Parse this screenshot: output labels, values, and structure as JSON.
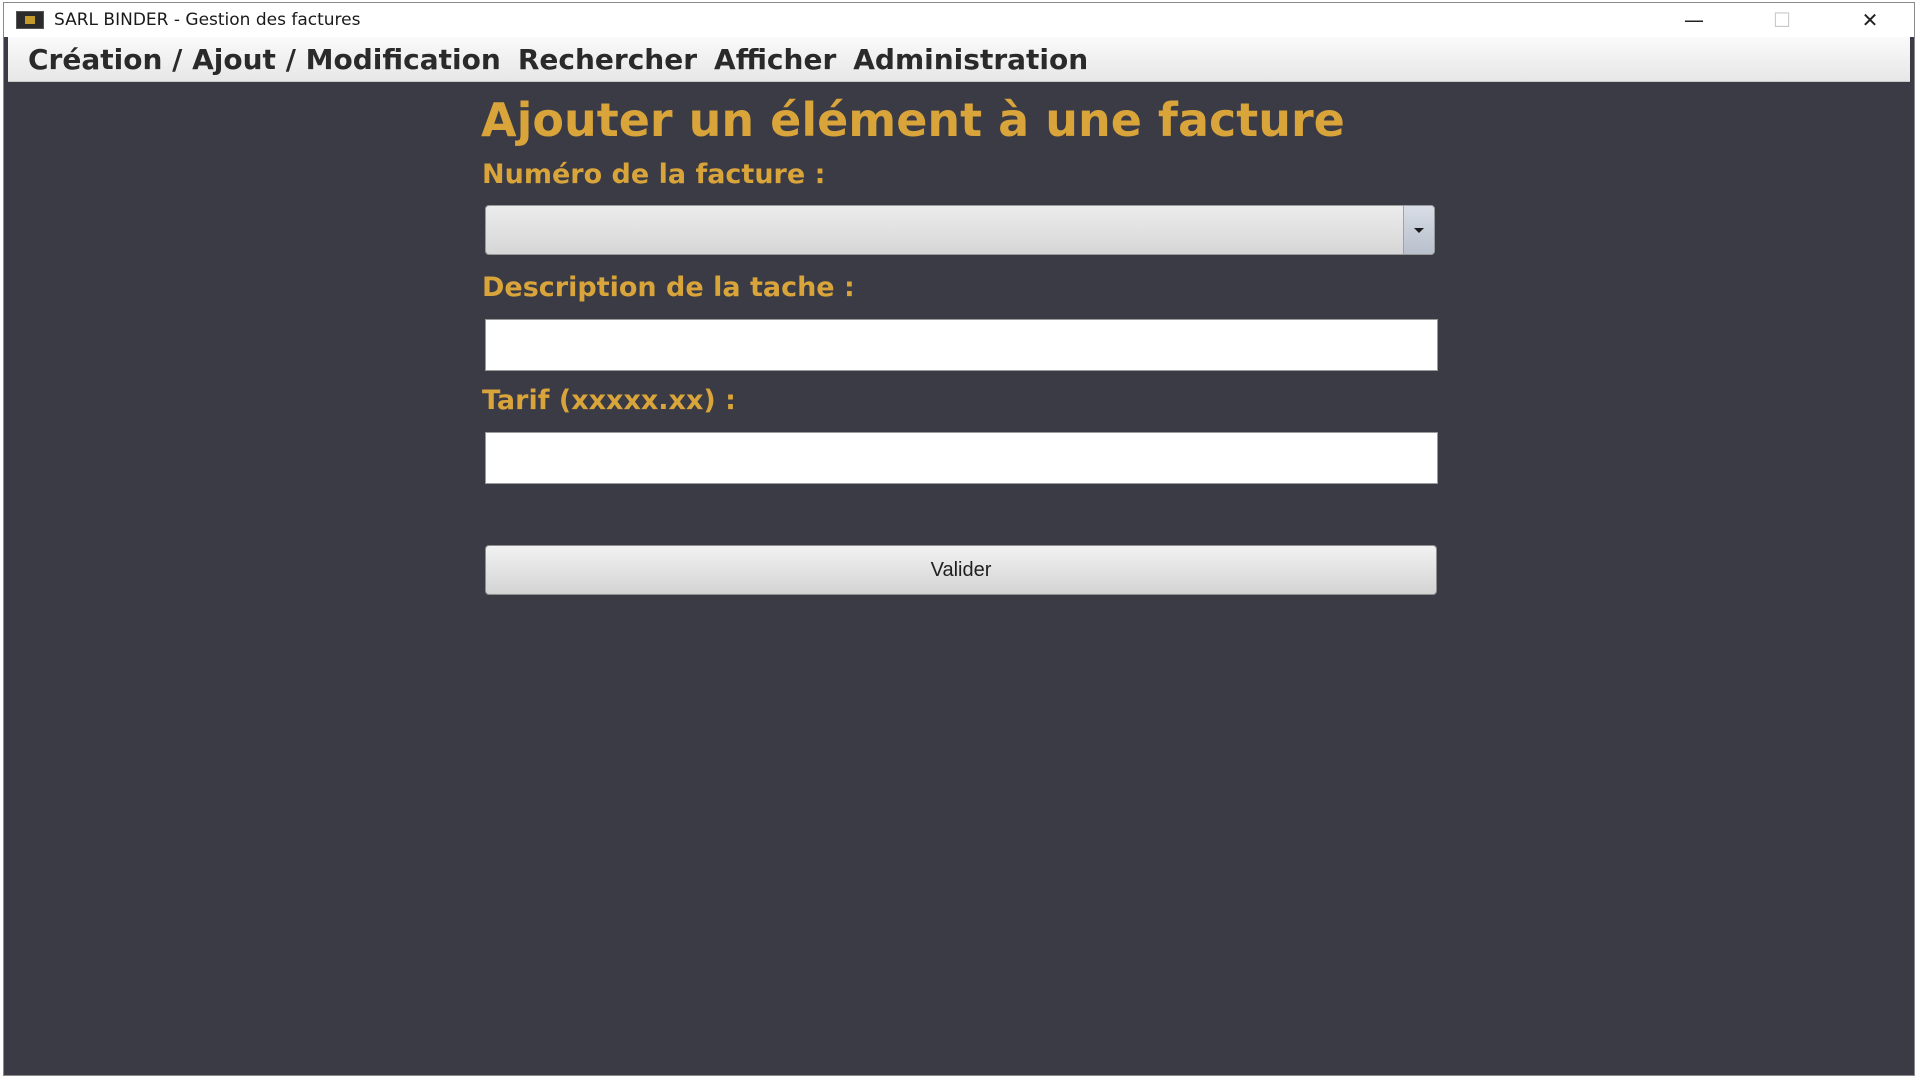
{
  "window": {
    "title": "SARL BINDER - Gestion des factures",
    "icon": "app-icon",
    "controls": {
      "minimize": "—",
      "maximize": "☐",
      "close": "✕"
    }
  },
  "menubar": {
    "items": [
      {
        "label": "Création / Ajout / Modification"
      },
      {
        "label": "Rechercher"
      },
      {
        "label": "Afficher"
      },
      {
        "label": "Administration"
      }
    ]
  },
  "form": {
    "title": "Ajouter un élément à une facture",
    "invoice_number": {
      "label": "Numéro de la facture :",
      "selected_value": ""
    },
    "description": {
      "label": "Description de la tache :",
      "value": "",
      "placeholder": ""
    },
    "rate": {
      "label": "Tarif (xxxxx.xx) :",
      "value": "",
      "placeholder": ""
    },
    "submit_label": "Valider"
  },
  "colors": {
    "background": "#3a3b45",
    "accent_label": "#d9a43a",
    "menubar": "#f0f0f0"
  }
}
